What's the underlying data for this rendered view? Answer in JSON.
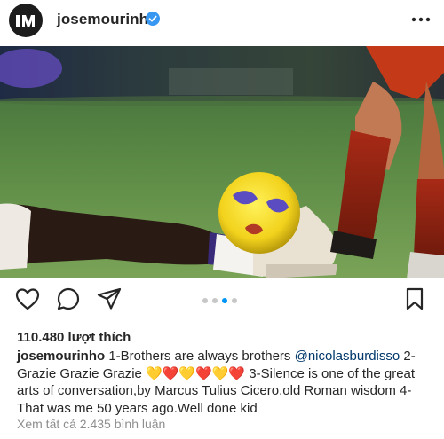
{
  "header": {
    "username": "josemourinho",
    "avatar_initials": "JM",
    "verified_icon": "verified-badge-icon",
    "more_icon": "more-options-icon",
    "verified_color": "#3897f0"
  },
  "post": {
    "image_icon": "football-photo",
    "carousel": {
      "count": 4,
      "active_index": 2
    }
  },
  "actions": {
    "like_icon": "heart-outline-icon",
    "comment_icon": "comment-icon",
    "share_icon": "send-icon",
    "save_icon": "bookmark-icon"
  },
  "likes": "110.480 lượt thích",
  "caption": {
    "username": "josemourinho",
    "text_part1": "1-Brothers are always brothers",
    "mention": "@nicolasburdisso",
    "text_part2": "2-Grazie Grazie Grazie",
    "hearts": "💛❤️💛❤️💛❤️",
    "text_part3": "3-Silence is one of the great arts of conversation,by Marcus Tulius Cicero,old Roman wisdom 4-That was me 50 years ago.Well done kid"
  },
  "comments_link": "Xem tất cả 2.435 bình luận",
  "colors": {
    "accent": "#0095f6",
    "mention": "#00376b",
    "muted": "#8e8e8e"
  }
}
